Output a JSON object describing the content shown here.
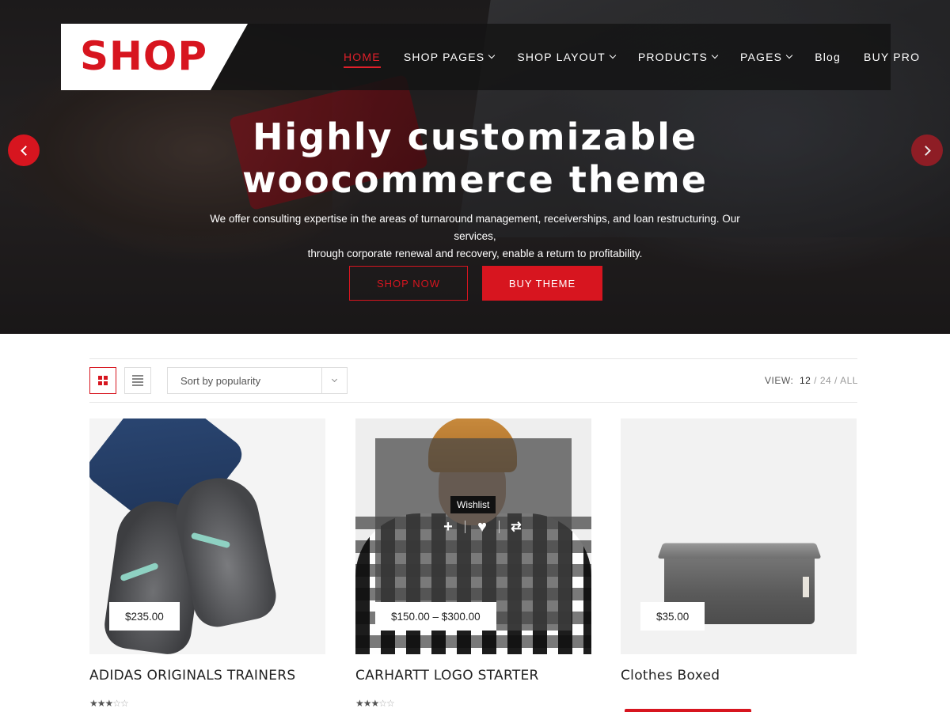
{
  "header": {
    "logo": "SHOP",
    "nav": [
      {
        "label": "HOME",
        "active": true,
        "dropdown": false
      },
      {
        "label": "SHOP PAGES",
        "active": false,
        "dropdown": true
      },
      {
        "label": "SHOP LAYOUT",
        "active": false,
        "dropdown": true
      },
      {
        "label": "PRODUCTS",
        "active": false,
        "dropdown": true
      },
      {
        "label": "PAGES",
        "active": false,
        "dropdown": true
      },
      {
        "label": "Blog",
        "active": false,
        "dropdown": false
      },
      {
        "label": "BUY PRO",
        "active": false,
        "dropdown": false
      }
    ]
  },
  "hero": {
    "title_line1": "Highly customizable",
    "title_line2": "woocommerce theme",
    "subtitle_line1": "We offer consulting expertise in the areas of turnaround management, receiverships, and loan restructuring. Our services,",
    "subtitle_line2": "through corporate renewal and recovery, enable a return to profitability.",
    "btn_shop": "SHOP NOW",
    "btn_buy": "BUY THEME",
    "prev_icon": "chevron-left-icon",
    "next_icon": "chevron-right-icon"
  },
  "toolbar": {
    "sort_value": "Sort by popularity",
    "view_label": "VIEW:",
    "view_options": [
      "12",
      "24",
      "ALL"
    ],
    "view_selected": "12"
  },
  "products": [
    {
      "title": "ADIDAS ORIGINALS TRAINERS",
      "price": "$235.00",
      "rating": 3
    },
    {
      "title": "CARHARTT LOGO STARTER",
      "price": "$150.00  –  $300.00",
      "rating": 3,
      "tooltip": "Wishlist"
    },
    {
      "title": "Clothes Boxed",
      "price": "$35.00",
      "rating": null
    }
  ],
  "colors": {
    "accent": "#d7151f",
    "dark_bar": "#141414"
  }
}
